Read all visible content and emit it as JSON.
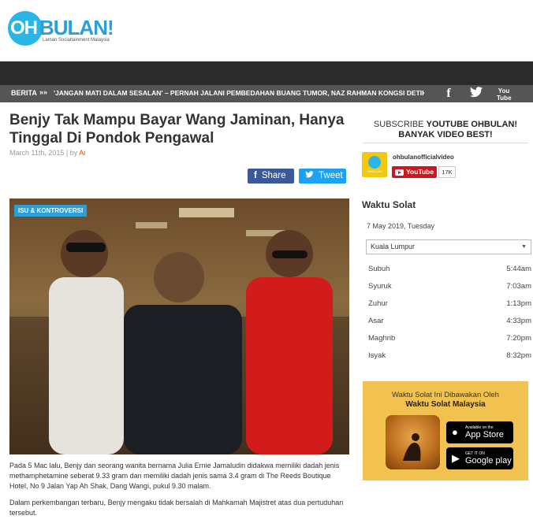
{
  "header": {
    "logo_oh": "OH",
    "logo_bulan": "BULAN!",
    "logo_tagline": "Laman Socialtainment Malaysia"
  },
  "newsbar": {
    "label": "BERITA",
    "arrows": "»»",
    "headline": "'JANGAN MATI DALAM SESALAN' – PERNAH JALANI PEMBEDAHAN BUANG TUMOR, NAZ RAHMAN KONGSI DETIK",
    "social": [
      "facebook-icon",
      "twitter-icon",
      "youtube-icon"
    ],
    "youtube_glyph": "You Tube"
  },
  "article": {
    "title": "Benjy Tak Mampu Bayar Wang Jaminan, Hanya Tinggal Di Pondok Pengawal",
    "date": "March 11th, 2015",
    "by": "by",
    "author": "Ai",
    "share_label": "Share",
    "tweet_label": "Tweet",
    "category_tag": "ISU & KONTROVERSI",
    "paragraph1": "Pada 5 Mac lalu, Benjy dan seorang wanita bernama Julia Ernie Jamaludin didakwa memiliki dadah jenis methamphetamine seberat 9.33 gram dan memiliki dadah jenis sama 3.4 gram di The Reeds Boutique Hotel, No 9 Jalan Yap Ah Shak, Dang Wangi, pukul 9.30 malam.",
    "paragraph2": "Dalam perkembangan terbaru, Benjy mengaku tidak bersalah di Mahkamah Majistret atas dua pertuduhan tersebut."
  },
  "sidebar": {
    "subscribe_prefix": "SUBSCRIBE",
    "subscribe_strong": "YOUTUBE OHBULAN!",
    "subscribe_line2": "BANYAK VIDEO BEST!",
    "channel_name": "ohbulanofficialvideo",
    "channel_avatar_text": "OHBULAN",
    "youtube_button": "YouTube",
    "subscriber_count": "17K",
    "waktu_solat_title": "Waktu Solat",
    "waktu_solat_date": "7 May 2019, Tuesday",
    "location_selected": "Kuala Lumpur",
    "prayer_times": [
      {
        "name": "Subuh",
        "time": "5:44am"
      },
      {
        "name": "Syuruk",
        "time": "7:03am"
      },
      {
        "name": "Zuhur",
        "time": "1:13pm"
      },
      {
        "name": "Asar",
        "time": "4:33pm"
      },
      {
        "name": "Maghrib",
        "time": "7:20pm"
      },
      {
        "name": "Isyak",
        "time": "8:32pm"
      }
    ],
    "ad_line1": "Waktu Solat Ini Dibawakan Oleh",
    "ad_line2": "Waktu Solat Malaysia",
    "appstore_small": "Available on the",
    "appstore_big": "App Store",
    "googleplay_small": "GET IT ON",
    "googleplay_big": "Google play"
  },
  "colors": {
    "brand_blue": "#2a9fd8",
    "dark_bar": "#2b2b2b",
    "news_bar": "#555555",
    "facebook": "#3b5998",
    "twitter": "#1da1f2",
    "youtube_red": "#cc181e",
    "ad_yellow": "#f1c24f"
  }
}
